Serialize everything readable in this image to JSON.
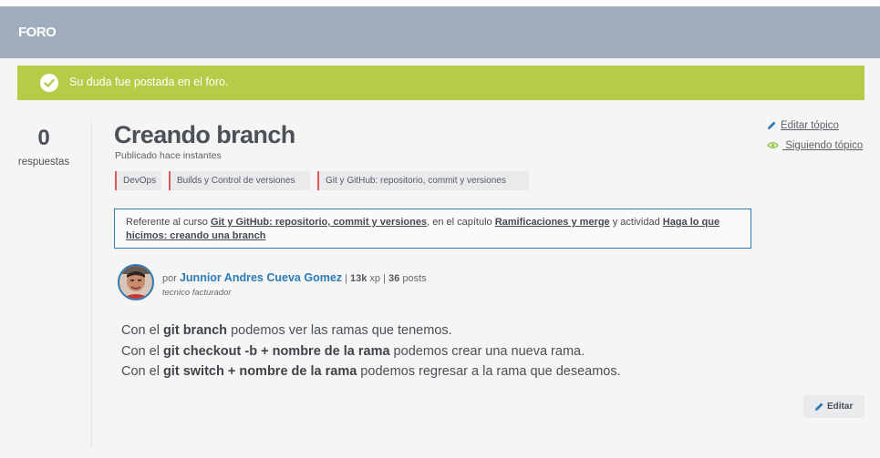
{
  "header": {
    "title": "FORO"
  },
  "alert": {
    "message": "Su duda fue postada en el foro."
  },
  "stats": {
    "count": "0",
    "label": "respuestas"
  },
  "topic": {
    "title": "Creando branch",
    "published": "Publicado hace instantes",
    "tags": [
      "DevOps",
      "Builds y Control de versiones",
      "Git y GitHub: repositorio, commit y versiones"
    ]
  },
  "reference": {
    "prefix": "Referente al curso ",
    "course": "Git y GitHub: repositorio, commit y versiones",
    "mid1": ", en el capítulo ",
    "chapter": "Ramificaciones y merge",
    "mid2": " y actividad ",
    "activity": "Haga lo que hicimos: creando una branch"
  },
  "author": {
    "prefix": "por ",
    "name": "Junnior Andres Cueva Gomez",
    "sep1": " | ",
    "xp_value": "13k",
    "xp_unit": " xp",
    "sep2": " | ",
    "posts_value": "36",
    "posts_unit": " posts",
    "role": "tecnico facturador"
  },
  "post": {
    "line1": {
      "a": "Con el ",
      "b": "git branch",
      "c": " podemos ver las ramas que tenemos."
    },
    "line2": {
      "a": "Con el ",
      "b": "git checkout -b + nombre de la rama",
      "c": " podemos crear una nueva rama."
    },
    "line3": {
      "a": "Con el ",
      "b": "git switch + nombre de la rama",
      "c": " podemos regresar a la rama que deseamos."
    }
  },
  "actions": {
    "edit_topic": "Editar tópico",
    "following": " Siguiendo tópico",
    "edit": "Editar"
  },
  "colors": {
    "header": "#a0adbf",
    "alert": "#b5cc48",
    "link": "#2c7bb6",
    "tag_accent": "#e05a5a",
    "follow_icon": "#8ec63f"
  }
}
